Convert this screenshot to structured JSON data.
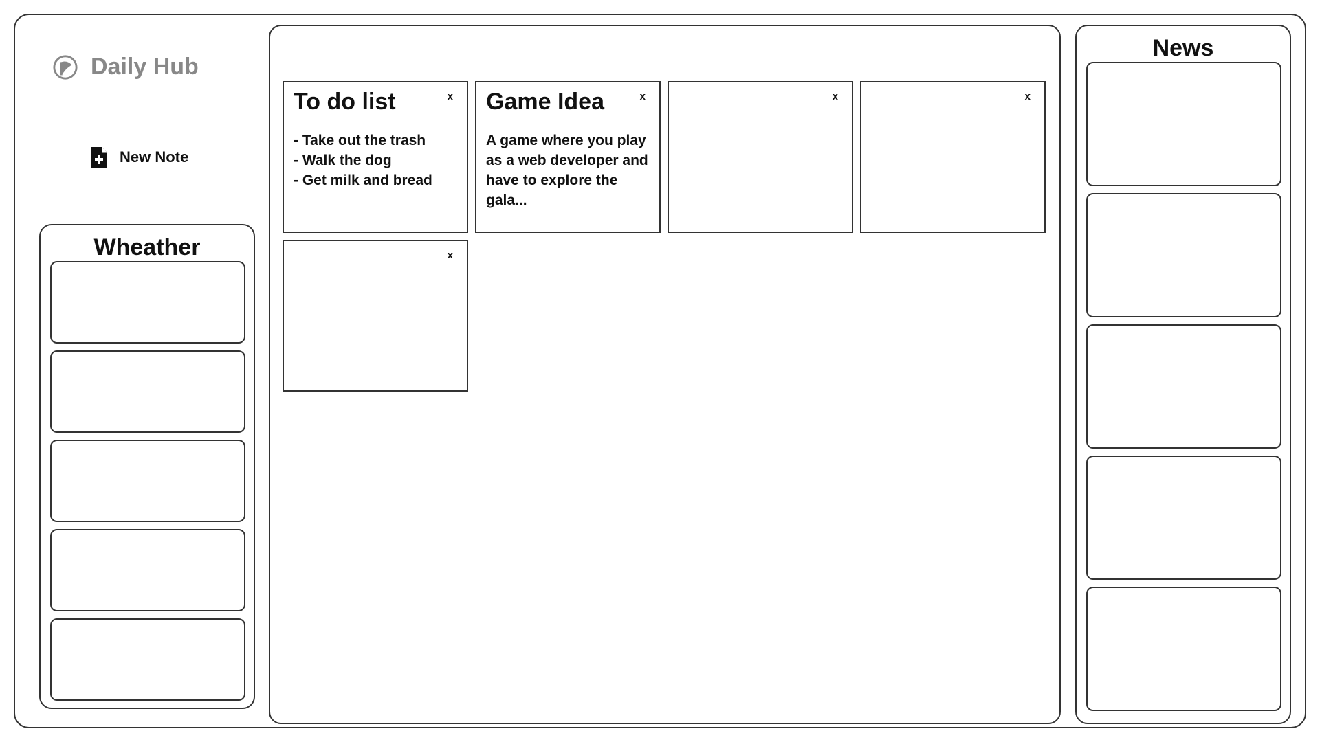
{
  "app": {
    "name": "Daily Hub",
    "logo_icon": "pinwheel-logo-icon",
    "logo_color": "#888888"
  },
  "sidebar": {
    "new_note_label": "New Note",
    "new_note_icon": "file-plus-icon"
  },
  "weather": {
    "title": "Wheather",
    "cards": [
      "",
      "",
      "",
      "",
      ""
    ]
  },
  "notes": [
    {
      "title": "To do list",
      "body": "- Take out the trash\n- Walk the dog\n- Get milk and bread",
      "close_label": "x"
    },
    {
      "title": "Game Idea",
      "body": "A game where you play as a web developer and have to explore the gala...",
      "close_label": "x"
    },
    {
      "title": "",
      "body": "",
      "close_label": "x"
    },
    {
      "title": "",
      "body": "",
      "close_label": "x"
    },
    {
      "title": "",
      "body": "",
      "close_label": "x"
    }
  ],
  "news": {
    "title": "News",
    "cards": [
      "",
      "",
      "",
      "",
      ""
    ]
  }
}
